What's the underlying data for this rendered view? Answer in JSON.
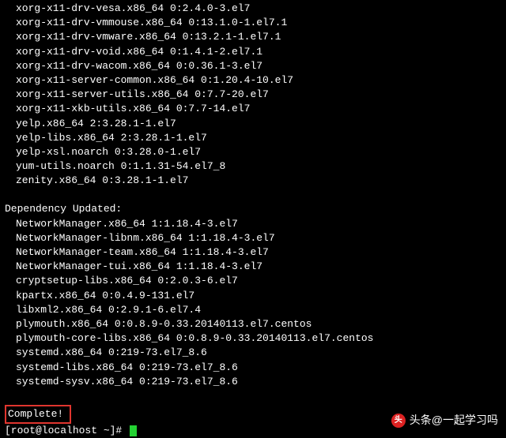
{
  "packages_top": [
    "xorg-x11-drv-vesa.x86_64 0:2.4.0-3.el7",
    "xorg-x11-drv-vmmouse.x86_64 0:13.1.0-1.el7.1",
    "xorg-x11-drv-vmware.x86_64 0:13.2.1-1.el7.1",
    "xorg-x11-drv-void.x86_64 0:1.4.1-2.el7.1",
    "xorg-x11-drv-wacom.x86_64 0:0.36.1-3.el7",
    "xorg-x11-server-common.x86_64 0:1.20.4-10.el7",
    "xorg-x11-server-utils.x86_64 0:7.7-20.el7",
    "xorg-x11-xkb-utils.x86_64 0:7.7-14.el7",
    "yelp.x86_64 2:3.28.1-1.el7",
    "yelp-libs.x86_64 2:3.28.1-1.el7",
    "yelp-xsl.noarch 0:3.28.0-1.el7",
    "yum-utils.noarch 0:1.1.31-54.el7_8",
    "zenity.x86_64 0:3.28.1-1.el7"
  ],
  "dep_header": "Dependency Updated:",
  "packages_dep": [
    "NetworkManager.x86_64 1:1.18.4-3.el7",
    "NetworkManager-libnm.x86_64 1:1.18.4-3.el7",
    "NetworkManager-team.x86_64 1:1.18.4-3.el7",
    "NetworkManager-tui.x86_64 1:1.18.4-3.el7",
    "cryptsetup-libs.x86_64 0:2.0.3-6.el7",
    "kpartx.x86_64 0:0.4.9-131.el7",
    "libxml2.x86_64 0:2.9.1-6.el7.4",
    "plymouth.x86_64 0:0.8.9-0.33.20140113.el7.centos",
    "plymouth-core-libs.x86_64 0:0.8.9-0.33.20140113.el7.centos",
    "systemd.x86_64 0:219-73.el7_8.6",
    "systemd-libs.x86_64 0:219-73.el7_8.6",
    "systemd-sysv.x86_64 0:219-73.el7_8.6"
  ],
  "complete_text": "Complete!",
  "prompt_text": "[root@localhost ~]# ",
  "watermark": {
    "logo_char": "头",
    "text": "头条@一起学习吗"
  }
}
